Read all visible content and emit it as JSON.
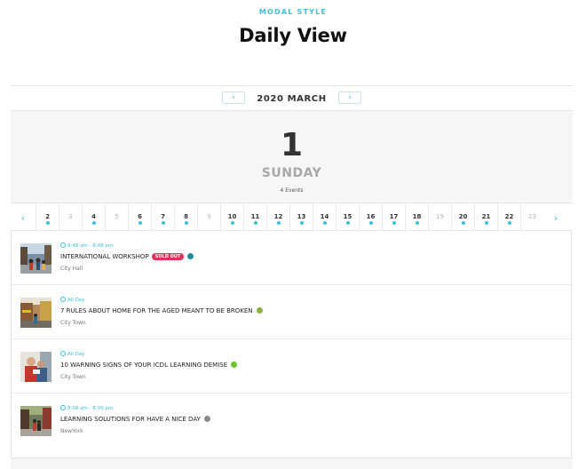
{
  "header": {
    "eyebrow": "MODAL STYLE",
    "title": "Daily View"
  },
  "calendar": {
    "month_label": "2020 MARCH",
    "prev_icon": "‹",
    "next_icon": "›",
    "selected_day": {
      "number": "1",
      "weekday": "SUNDAY",
      "event_count": "4 Events"
    },
    "strip": {
      "prev_icon": "‹",
      "next_icon": "›",
      "days": [
        {
          "label": "2",
          "has_event": true
        },
        {
          "label": "3",
          "has_event": false
        },
        {
          "label": "4",
          "has_event": true
        },
        {
          "label": "5",
          "has_event": false
        },
        {
          "label": "6",
          "has_event": true
        },
        {
          "label": "7",
          "has_event": true
        },
        {
          "label": "8",
          "has_event": true
        },
        {
          "label": "9",
          "has_event": false
        },
        {
          "label": "10",
          "has_event": true
        },
        {
          "label": "11",
          "has_event": true
        },
        {
          "label": "12",
          "has_event": true
        },
        {
          "label": "13",
          "has_event": true
        },
        {
          "label": "14",
          "has_event": true
        },
        {
          "label": "15",
          "has_event": true
        },
        {
          "label": "16",
          "has_event": true
        },
        {
          "label": "17",
          "has_event": true
        },
        {
          "label": "18",
          "has_event": true
        },
        {
          "label": "19",
          "has_event": false
        },
        {
          "label": "20",
          "has_event": true
        },
        {
          "label": "21",
          "has_event": true
        },
        {
          "label": "22",
          "has_event": true
        },
        {
          "label": "23",
          "has_event": false
        }
      ]
    }
  },
  "events": [
    {
      "time": "8:48 am - 8:48 pm",
      "title": "INTERNATIONAL WORKSHOP",
      "badge": "SOLD OUT",
      "category_color": "#1e8c9c",
      "location": "City Hall",
      "thumb_scene": "street-crowd"
    },
    {
      "time": "All Day",
      "title": "7 RULES ABOUT HOME FOR THE AGED MEANT TO BE BROKEN",
      "badge": "",
      "category_color": "#8cb23a",
      "location": "City Town",
      "thumb_scene": "market-street"
    },
    {
      "time": "All Day",
      "title": "10 WARNING SIGNS OF YOUR ICDL LEARNING DEMISE",
      "badge": "",
      "category_color": "#6cc22e",
      "location": "City Town",
      "thumb_scene": "people-closeup"
    },
    {
      "time": "8:08 am - 8:00 pm",
      "title": "LEARNING SOLUTIONS FOR HAVE A NICE DAY",
      "badge": "",
      "category_color": "#8a8a8a",
      "location": "NewYork",
      "thumb_scene": "city-sidewalk"
    }
  ]
}
